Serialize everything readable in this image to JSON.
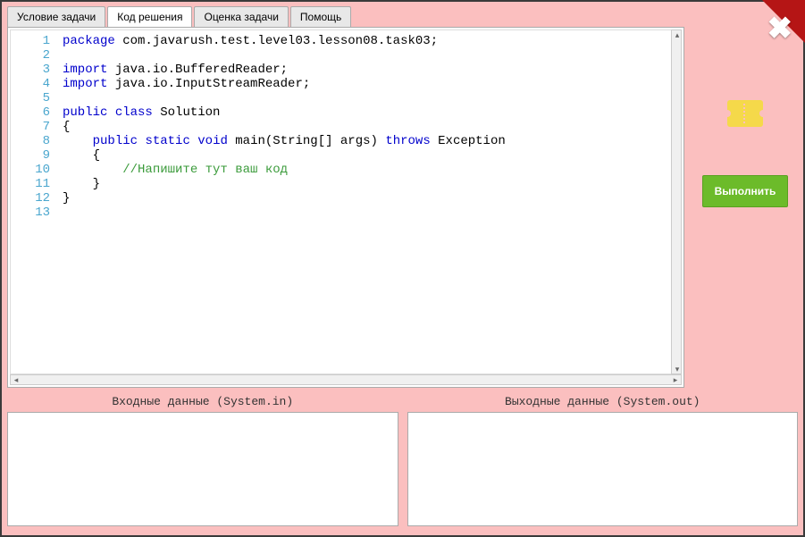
{
  "tabs": [
    {
      "label": "Условие задачи"
    },
    {
      "label": "Код решения"
    },
    {
      "label": "Оценка задачи"
    },
    {
      "label": "Помощь"
    }
  ],
  "active_tab_index": 1,
  "code_lines": [
    {
      "n": 1,
      "tokens": [
        [
          "kw",
          "package"
        ],
        [
          "sp",
          " "
        ],
        [
          "pkg",
          "com.javarush.test.level03.lesson08.task03"
        ],
        [
          "txt",
          ";"
        ]
      ]
    },
    {
      "n": 2,
      "tokens": []
    },
    {
      "n": 3,
      "tokens": [
        [
          "kw",
          "import"
        ],
        [
          "sp",
          " "
        ],
        [
          "pkg",
          "java.io.BufferedReader"
        ],
        [
          "txt",
          ";"
        ]
      ]
    },
    {
      "n": 4,
      "tokens": [
        [
          "kw",
          "import"
        ],
        [
          "sp",
          " "
        ],
        [
          "pkg",
          "java.io.InputStreamReader"
        ],
        [
          "txt",
          ";"
        ]
      ]
    },
    {
      "n": 5,
      "tokens": []
    },
    {
      "n": 6,
      "tokens": [
        [
          "kw",
          "public"
        ],
        [
          "sp",
          " "
        ],
        [
          "kw",
          "class"
        ],
        [
          "sp",
          " "
        ],
        [
          "txt",
          "Solution"
        ]
      ]
    },
    {
      "n": 7,
      "tokens": [
        [
          "txt",
          "{"
        ]
      ]
    },
    {
      "n": 8,
      "tokens": [
        [
          "sp",
          "    "
        ],
        [
          "kw",
          "public"
        ],
        [
          "sp",
          " "
        ],
        [
          "kw",
          "static"
        ],
        [
          "sp",
          " "
        ],
        [
          "kw",
          "void"
        ],
        [
          "sp",
          " "
        ],
        [
          "txt",
          "main(String[] args) "
        ],
        [
          "kw",
          "throws"
        ],
        [
          "sp",
          " "
        ],
        [
          "txt",
          "Exception"
        ]
      ]
    },
    {
      "n": 9,
      "tokens": [
        [
          "sp",
          "    "
        ],
        [
          "txt",
          "{"
        ]
      ]
    },
    {
      "n": 10,
      "tokens": [
        [
          "sp",
          "        "
        ],
        [
          "comment",
          "//Напишите тут ваш код"
        ]
      ]
    },
    {
      "n": 11,
      "tokens": [
        [
          "sp",
          "    "
        ],
        [
          "txt",
          "}"
        ]
      ]
    },
    {
      "n": 12,
      "tokens": [
        [
          "txt",
          "}"
        ]
      ]
    },
    {
      "n": 13,
      "tokens": []
    }
  ],
  "io": {
    "input_label": "Входные данные (System.in)",
    "output_label": "Выходные данные (System.out)",
    "input_value": "",
    "output_value": ""
  },
  "actions": {
    "run_label": "Выполнить",
    "close_label": "✖"
  }
}
